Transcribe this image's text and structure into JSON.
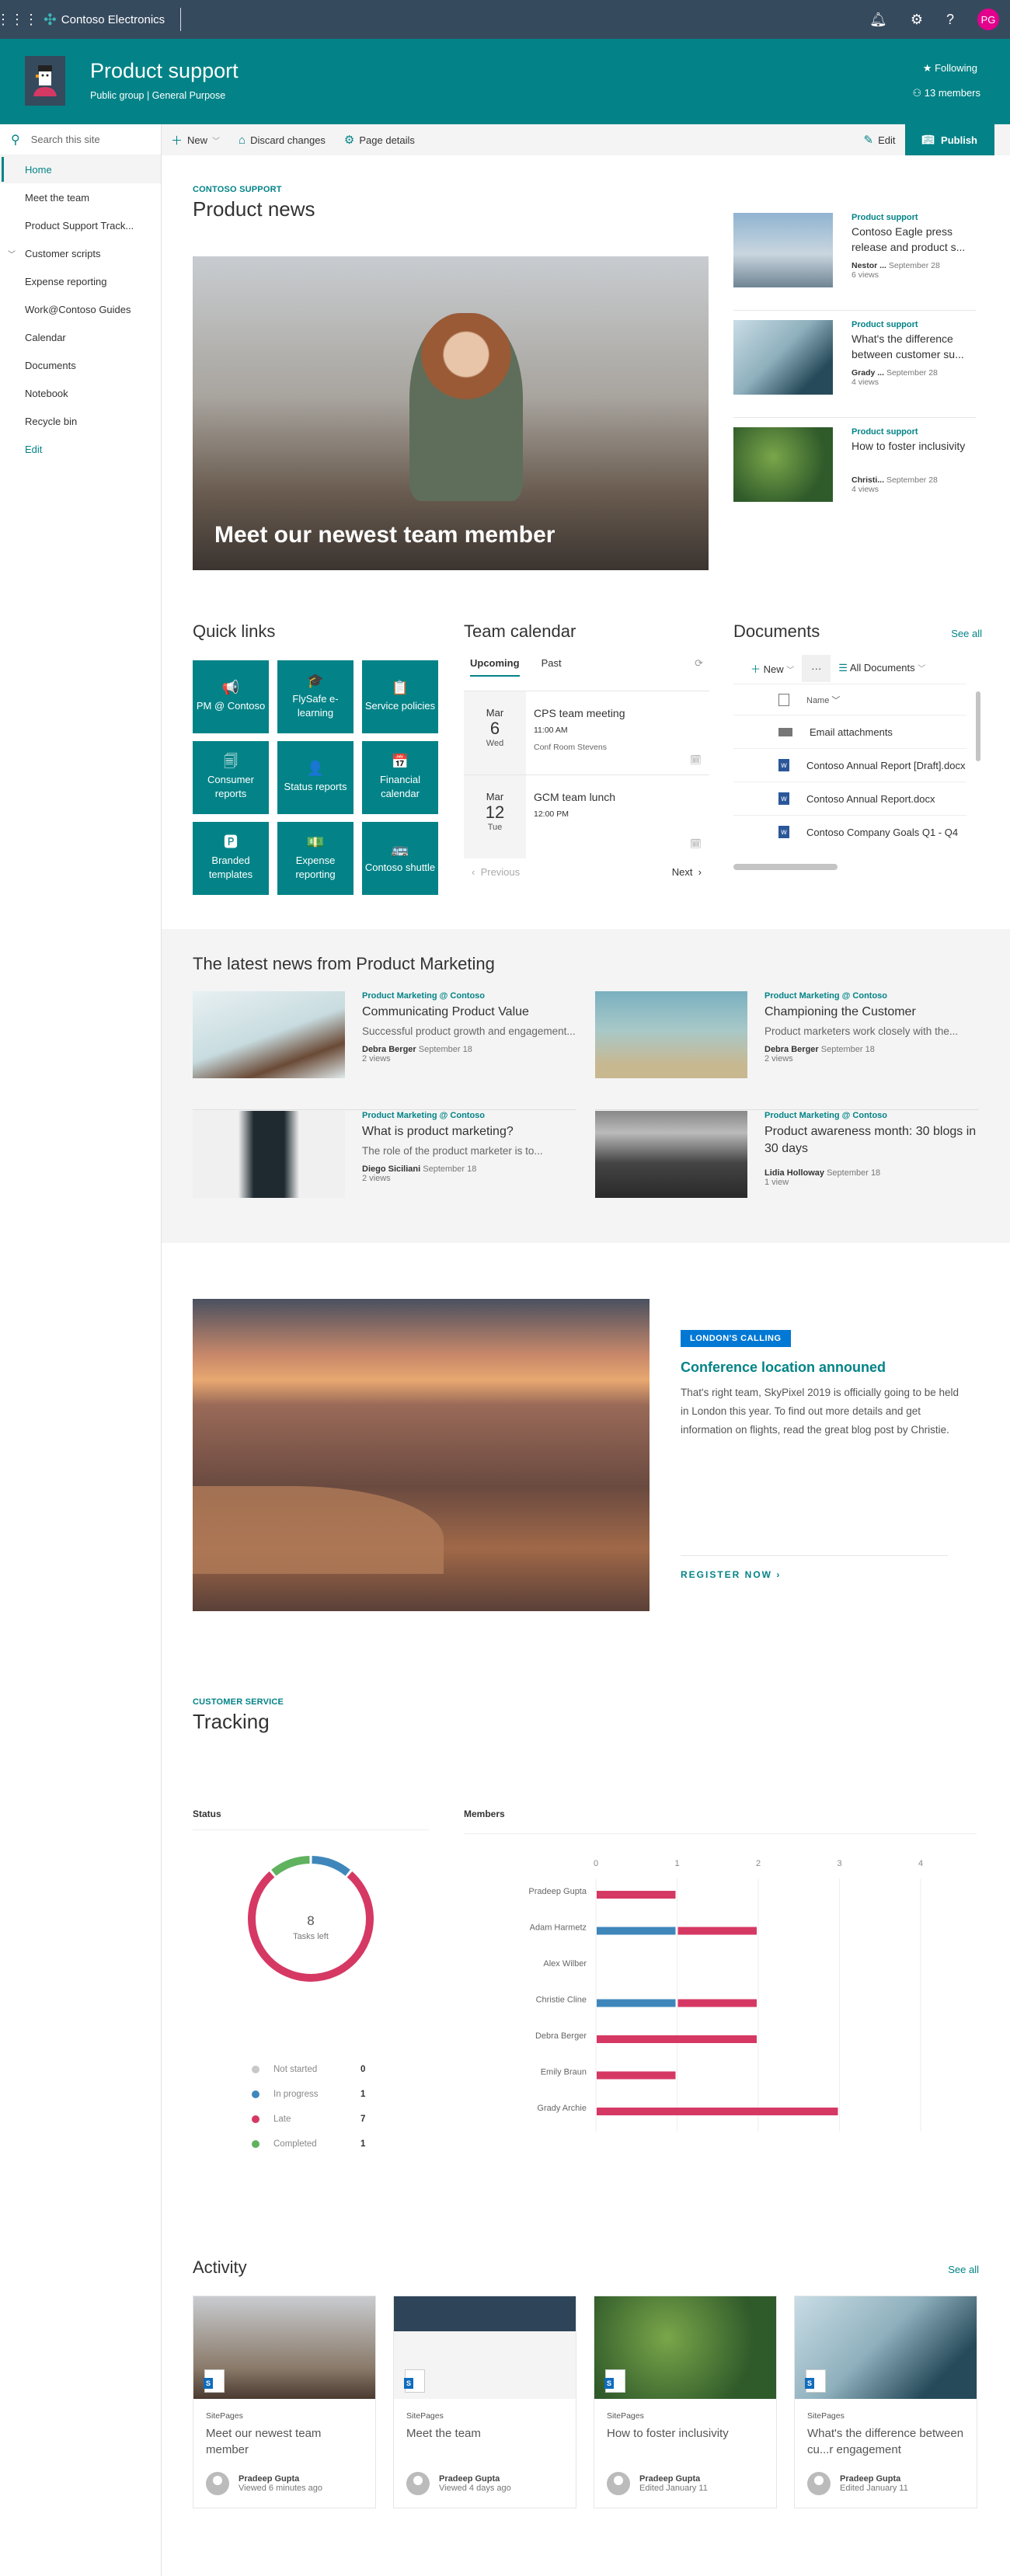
{
  "suitebar": {
    "brand": "Contoso Electronics",
    "avatar_initials": "PG",
    "icons": [
      "waffle-icon",
      "bell-icon",
      "gear-icon",
      "help-icon"
    ]
  },
  "site": {
    "title": "Product support",
    "subtitle": "Public group | General Purpose",
    "following": "Following",
    "members": "13 members"
  },
  "commandbar": {
    "new": "New",
    "discard": "Discard changes",
    "page_details": "Page details",
    "edit": "Edit",
    "publish": "Publish"
  },
  "nav": {
    "search_placeholder": "Search this site",
    "items": [
      "Home",
      "Meet the team",
      "Product Support Track...",
      "Customer scripts",
      "Expense reporting",
      "Work@Contoso Guides",
      "Calendar",
      "Documents",
      "Notebook",
      "Recycle bin"
    ],
    "edit": "Edit"
  },
  "news": {
    "eyebrow": "CONTOSO SUPPORT",
    "title": "Product news",
    "hero_caption": "Meet our newest team member",
    "side": [
      {
        "category": "Product support",
        "title": "Contoso Eagle press release and product s...",
        "author": "Nestor ...",
        "date": "September 28",
        "views": "6 views"
      },
      {
        "category": "Product support",
        "title": "What's the difference between customer su...",
        "author": "Grady ...",
        "date": "September 28",
        "views": "4 views"
      },
      {
        "category": "Product support",
        "title": "How to foster inclusivity",
        "author": "Christi...",
        "date": "September 28",
        "views": "4 views"
      }
    ]
  },
  "quicklinks": {
    "title": "Quick links",
    "items": [
      {
        "label": "PM @ Contoso",
        "icon": "megaphone-icon",
        "glyph": "📢"
      },
      {
        "label": "FlySafe e-learning",
        "icon": "graduation-cap-icon",
        "glyph": "🎓"
      },
      {
        "label": "Service policies",
        "icon": "clipboard-icon",
        "glyph": "📋"
      },
      {
        "label": "Consumer reports",
        "icon": "documents-icon",
        "glyph": "🗐"
      },
      {
        "label": "Status reports",
        "icon": "person-check-icon",
        "glyph": "👤"
      },
      {
        "label": "Financial calendar",
        "icon": "calendar-icon",
        "glyph": "📅"
      },
      {
        "label": "Branded templates",
        "icon": "powerpoint-icon",
        "glyph": "🅿"
      },
      {
        "label": "Expense reporting",
        "icon": "money-icon",
        "glyph": "💵"
      },
      {
        "label": "Contoso shuttle",
        "icon": "bus-icon",
        "glyph": "🚌"
      }
    ]
  },
  "calendar": {
    "title": "Team calendar",
    "tabs": [
      "Upcoming",
      "Past"
    ],
    "events": [
      {
        "month": "Mar",
        "day": "6",
        "weekday": "Wed",
        "title": "CPS team meeting",
        "time": "11:00 AM",
        "location": "Conf Room Stevens"
      },
      {
        "month": "Mar",
        "day": "12",
        "weekday": "Tue",
        "title": "GCM team lunch",
        "time": "12:00 PM",
        "location": ""
      }
    ],
    "previous": "Previous",
    "next": "Next"
  },
  "documents": {
    "title": "Documents",
    "see_all": "See all",
    "new": "New",
    "view": "All Documents",
    "column": "Name",
    "rows": [
      {
        "name": "Email attachments",
        "type": "folder"
      },
      {
        "name": "Contoso Annual Report [Draft].docx",
        "type": "word"
      },
      {
        "name": "Contoso Annual Report.docx",
        "type": "word"
      },
      {
        "name": "Contoso Company Goals Q1 - Q4",
        "type": "word"
      }
    ]
  },
  "marketing": {
    "title": "The latest news from Product Marketing",
    "items": [
      {
        "category": "Product Marketing @ Contoso",
        "title": "Communicating Product Value",
        "desc": "Successful product growth and engagement...",
        "author": "Debra Berger",
        "date": "September 18",
        "views": "2 views"
      },
      {
        "category": "Product Marketing @ Contoso",
        "title": "Championing the Customer",
        "desc": "Product marketers work closely with the...",
        "author": "Debra Berger",
        "date": "September 18",
        "views": "2 views"
      },
      {
        "category": "Product Marketing @ Contoso",
        "title": "What is product marketing?",
        "desc": "The role of the product marketer is to...",
        "author": "Diego Siciliani",
        "date": "September 18",
        "views": "2 views"
      },
      {
        "category": "Product Marketing @ Contoso",
        "title": "Product awareness month: 30 blogs in 30 days",
        "desc": "",
        "author": "Lidia Holloway",
        "date": "September 18",
        "views": "1 view"
      }
    ]
  },
  "banner": {
    "tag": "LONDON'S CALLING",
    "title": "Conference location announed",
    "body": "That's right team, SkyPixel 2019 is officially going to be held in London this year. To find out more details and get information on flights, read the great blog post by Christie.",
    "cta": "REGISTER NOW"
  },
  "tracking": {
    "eyebrow": "CUSTOMER SERVICE",
    "title": "Tracking",
    "status_label": "Status",
    "members_label": "Members",
    "center_value": "8",
    "center_label": "Tasks left"
  },
  "colors": {
    "accent": "#038387",
    "not_started": "#c8c8c8",
    "in_progress": "#3f87bb",
    "late": "#d63864",
    "completed": "#60b25f"
  },
  "chart_data": [
    {
      "type": "pie",
      "title": "Status",
      "categories": [
        "Not started",
        "In progress",
        "Late",
        "Completed"
      ],
      "values": [
        0,
        1,
        7,
        1
      ],
      "center_text": "8 Tasks left"
    },
    {
      "type": "bar",
      "orientation": "horizontal",
      "stacked": true,
      "title": "Members",
      "categories": [
        "Pradeep Gupta",
        "Adam Harmetz",
        "Alex Wilber",
        "Christie Cline",
        "Debra Berger",
        "Emily Braun",
        "Grady Archie"
      ],
      "series": [
        {
          "name": "In progress",
          "values": [
            0,
            1,
            0,
            1,
            0,
            0,
            0
          ]
        },
        {
          "name": "Late",
          "values": [
            1,
            1,
            0,
            1,
            2,
            1,
            3
          ]
        }
      ],
      "xlim": [
        0,
        4
      ],
      "xticks": [
        "0",
        "1",
        "2",
        "3",
        "4"
      ],
      "grid": true
    }
  ],
  "activity": {
    "title": "Activity",
    "see_all": "See all",
    "cards": [
      {
        "source": "SitePages",
        "title": "Meet our newest team member",
        "user": "Pradeep Gupta",
        "when": "Viewed 6 minutes ago"
      },
      {
        "source": "SitePages",
        "title": "Meet the team",
        "user": "Pradeep Gupta",
        "when": "Viewed 4 days ago"
      },
      {
        "source": "SitePages",
        "title": "How to foster inclusivity",
        "user": "Pradeep Gupta",
        "when": "Edited January 11"
      },
      {
        "source": "SitePages",
        "title": "What's the difference between cu...r engagement",
        "user": "Pradeep Gupta",
        "when": "Edited January 11"
      }
    ]
  }
}
